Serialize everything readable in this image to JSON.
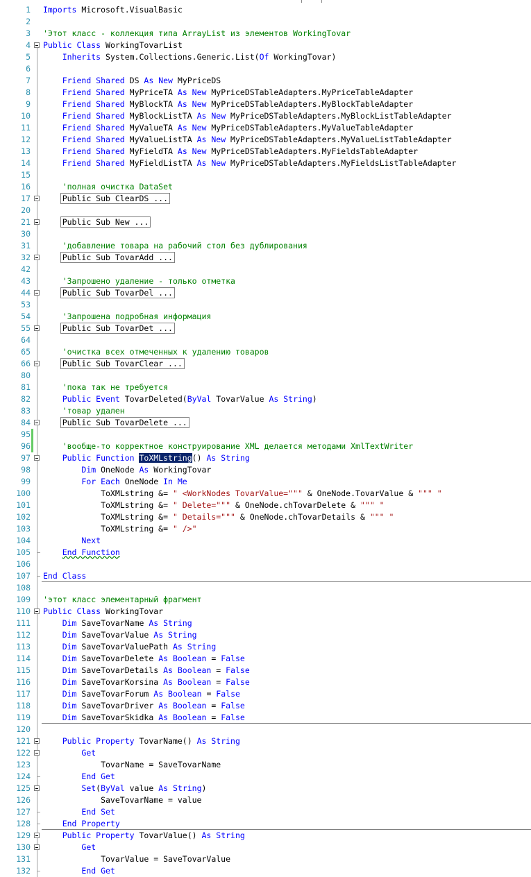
{
  "editor": {
    "lines": [
      {
        "n": "1",
        "t": [
          [
            "kw",
            "Imports"
          ],
          [
            "",
            "Microsoft.VisualBasic"
          ]
        ]
      },
      {
        "n": "2",
        "t": []
      },
      {
        "n": "3",
        "t": [
          [
            "cm",
            "'Этот класс - коллекция типа ArrayList из элементов WorkingTovar"
          ]
        ]
      },
      {
        "n": "4",
        "t": [
          [
            "kw",
            "Public Class"
          ],
          [
            "",
            "WorkingTovarList"
          ]
        ],
        "f": "box"
      },
      {
        "n": "5",
        "t": [
          [
            "",
            "    "
          ],
          [
            "kw",
            "Inherits"
          ],
          [
            "",
            "System.Collections.Generic.List("
          ],
          [
            "kw",
            "Of"
          ],
          [
            "",
            "WorkingTovar)"
          ]
        ]
      },
      {
        "n": "6",
        "t": []
      },
      {
        "n": "7",
        "t": [
          [
            "",
            "    "
          ],
          [
            "kw",
            "Friend Shared"
          ],
          [
            "",
            "DS "
          ],
          [
            "kw",
            "As New"
          ],
          [
            "",
            "MyPriceDS"
          ]
        ]
      },
      {
        "n": "8",
        "t": [
          [
            "",
            "    "
          ],
          [
            "kw",
            "Friend Shared"
          ],
          [
            "",
            "MyPriceTA "
          ],
          [
            "kw",
            "As New"
          ],
          [
            "",
            "MyPriceDSTableAdapters.MyPriceTableAdapter"
          ]
        ]
      },
      {
        "n": "9",
        "t": [
          [
            "",
            "    "
          ],
          [
            "kw",
            "Friend Shared"
          ],
          [
            "",
            "MyBlockTA "
          ],
          [
            "kw",
            "As New"
          ],
          [
            "",
            "MyPriceDSTableAdapters.MyBlockTableAdapter"
          ]
        ]
      },
      {
        "n": "10",
        "t": [
          [
            "",
            "    "
          ],
          [
            "kw",
            "Friend Shared"
          ],
          [
            "",
            "MyBlockListTA "
          ],
          [
            "kw",
            "As New"
          ],
          [
            "",
            "MyPriceDSTableAdapters.MyBlockListTableAdapter"
          ]
        ]
      },
      {
        "n": "11",
        "t": [
          [
            "",
            "    "
          ],
          [
            "kw",
            "Friend Shared"
          ],
          [
            "",
            "MyValueTA "
          ],
          [
            "kw",
            "As New"
          ],
          [
            "",
            "MyPriceDSTableAdapters.MyValueTableAdapter"
          ]
        ]
      },
      {
        "n": "12",
        "t": [
          [
            "",
            "    "
          ],
          [
            "kw",
            "Friend Shared"
          ],
          [
            "",
            "MyValueListTA "
          ],
          [
            "kw",
            "As New"
          ],
          [
            "",
            "MyPriceDSTableAdapters.MyValueListTableAdapter"
          ]
        ]
      },
      {
        "n": "13",
        "t": [
          [
            "",
            "    "
          ],
          [
            "kw",
            "Friend Shared"
          ],
          [
            "",
            "MyFieldTA "
          ],
          [
            "kw",
            "As New"
          ],
          [
            "",
            "MyPriceDSTableAdapters.MyFieldsTableAdapter"
          ]
        ]
      },
      {
        "n": "14",
        "t": [
          [
            "",
            "    "
          ],
          [
            "kw",
            "Friend Shared"
          ],
          [
            "",
            "MyFieldListTA "
          ],
          [
            "kw",
            "As New"
          ],
          [
            "",
            "MyPriceDSTableAdapters.MyFieldsListTableAdapter"
          ]
        ]
      },
      {
        "n": "15",
        "t": []
      },
      {
        "n": "16",
        "t": [
          [
            "",
            "    "
          ],
          [
            "cm",
            "'полная очистка DataSet"
          ]
        ]
      },
      {
        "n": "17",
        "t": [
          [
            "",
            "    "
          ],
          [
            "coll",
            "Public Sub ClearDS ..."
          ]
        ],
        "f": "box"
      },
      {
        "n": "20",
        "t": []
      },
      {
        "n": "21",
        "t": [
          [
            "",
            "    "
          ],
          [
            "coll",
            "Public Sub New ..."
          ]
        ],
        "f": "box"
      },
      {
        "n": "30",
        "t": []
      },
      {
        "n": "31",
        "t": [
          [
            "",
            "    "
          ],
          [
            "cm",
            "'добавление товара на рабочий стол без дублирования"
          ]
        ]
      },
      {
        "n": "32",
        "t": [
          [
            "",
            "    "
          ],
          [
            "coll",
            "Public Sub TovarAdd ..."
          ]
        ],
        "f": "box"
      },
      {
        "n": "42",
        "t": []
      },
      {
        "n": "43",
        "t": [
          [
            "",
            "    "
          ],
          [
            "cm",
            "'Запрошено удаление - только отметка"
          ]
        ]
      },
      {
        "n": "44",
        "t": [
          [
            "",
            "    "
          ],
          [
            "coll",
            "Public Sub TovarDel ..."
          ]
        ],
        "f": "box"
      },
      {
        "n": "53",
        "t": []
      },
      {
        "n": "54",
        "t": [
          [
            "",
            "    "
          ],
          [
            "cm",
            "'Запрошена подробная информация"
          ]
        ]
      },
      {
        "n": "55",
        "t": [
          [
            "",
            "    "
          ],
          [
            "coll",
            "Public Sub TovarDet ..."
          ]
        ],
        "f": "box"
      },
      {
        "n": "64",
        "t": []
      },
      {
        "n": "65",
        "t": [
          [
            "",
            "    "
          ],
          [
            "cm",
            "'очистка всех отмеченных к удалению товаров"
          ]
        ]
      },
      {
        "n": "66",
        "t": [
          [
            "",
            "    "
          ],
          [
            "coll",
            "Public Sub TovarClear ..."
          ]
        ],
        "f": "box"
      },
      {
        "n": "80",
        "t": []
      },
      {
        "n": "81",
        "t": [
          [
            "",
            "    "
          ],
          [
            "cm",
            "'пока так не требуется"
          ]
        ]
      },
      {
        "n": "82",
        "t": [
          [
            "",
            "    "
          ],
          [
            "kw",
            "Public Event"
          ],
          [
            "",
            "TovarDeleted("
          ],
          [
            "kw",
            "ByVal"
          ],
          [
            "",
            "TovarValue "
          ],
          [
            "kw",
            "As String"
          ],
          [
            "",
            ")"
          ]
        ]
      },
      {
        "n": "83",
        "t": [
          [
            "",
            "    "
          ],
          [
            "cm",
            "'товар удален"
          ]
        ]
      },
      {
        "n": "84",
        "t": [
          [
            "",
            "    "
          ],
          [
            "coll",
            "Public Sub TovarDelete ..."
          ]
        ],
        "f": "box"
      },
      {
        "n": "95",
        "t": [],
        "chg": true
      },
      {
        "n": "96",
        "t": [
          [
            "",
            "    "
          ],
          [
            "cm",
            "'вообще-то корректное конструирование XML делается методами XmlTextWriter"
          ]
        ],
        "chg": true
      },
      {
        "n": "97",
        "t": [
          [
            "",
            "    "
          ],
          [
            "kw",
            "Public Function"
          ],
          [
            "sel",
            "ToXMLstring"
          ],
          [
            "",
            "() "
          ],
          [
            "kw",
            "As String"
          ]
        ],
        "f": "box"
      },
      {
        "n": "98",
        "t": [
          [
            "",
            "        "
          ],
          [
            "kw",
            "Dim"
          ],
          [
            "",
            "OneNode "
          ],
          [
            "kw",
            "As"
          ],
          [
            "",
            "WorkingTovar"
          ]
        ]
      },
      {
        "n": "99",
        "t": [
          [
            "",
            "        "
          ],
          [
            "kw",
            "For Each"
          ],
          [
            "",
            "OneNode "
          ],
          [
            "kw",
            "In Me"
          ]
        ]
      },
      {
        "n": "100",
        "t": [
          [
            "",
            "            ToXMLstring &= "
          ],
          [
            "st",
            "\" <WorkNodes TovarValue=\"\"\""
          ],
          [
            "",
            " & OneNode.TovarValue & "
          ],
          [
            "st",
            "\"\"\" \""
          ]
        ]
      },
      {
        "n": "101",
        "t": [
          [
            "",
            "            ToXMLstring &= "
          ],
          [
            "st",
            "\" Delete=\"\"\""
          ],
          [
            "",
            " & OneNode.chTovarDelete & "
          ],
          [
            "st",
            "\"\"\" \""
          ]
        ]
      },
      {
        "n": "102",
        "t": [
          [
            "",
            "            ToXMLstring &= "
          ],
          [
            "st",
            "\" Details=\"\"\""
          ],
          [
            "",
            " & OneNode.chTovarDetails & "
          ],
          [
            "st",
            "\"\"\" \""
          ]
        ]
      },
      {
        "n": "103",
        "t": [
          [
            "",
            "            ToXMLstring &= "
          ],
          [
            "st",
            "\" />\""
          ]
        ]
      },
      {
        "n": "104",
        "t": [
          [
            "",
            "        "
          ],
          [
            "kw",
            "Next"
          ]
        ]
      },
      {
        "n": "105",
        "t": [
          [
            "",
            "    "
          ],
          [
            "kw",
            "End Function"
          ]
        ],
        "f": "end"
      },
      {
        "n": "106",
        "t": []
      },
      {
        "n": "107",
        "t": [
          [
            "kw",
            "End Class"
          ]
        ],
        "f": "end",
        "sep": true
      },
      {
        "n": "108",
        "t": []
      },
      {
        "n": "109",
        "t": [
          [
            "cm",
            "'этот класс элементарный фрагмент"
          ]
        ]
      },
      {
        "n": "110",
        "t": [
          [
            "kw",
            "Public Class"
          ],
          [
            "",
            "WorkingTovar"
          ]
        ],
        "f": "box"
      },
      {
        "n": "111",
        "t": [
          [
            "",
            "    "
          ],
          [
            "kw",
            "Dim"
          ],
          [
            "",
            "SaveTovarName "
          ],
          [
            "kw",
            "As String"
          ]
        ]
      },
      {
        "n": "112",
        "t": [
          [
            "",
            "    "
          ],
          [
            "kw",
            "Dim"
          ],
          [
            "",
            "SaveTovarValue "
          ],
          [
            "kw",
            "As String"
          ]
        ]
      },
      {
        "n": "113",
        "t": [
          [
            "",
            "    "
          ],
          [
            "kw",
            "Dim"
          ],
          [
            "",
            "SaveTovarValuePath "
          ],
          [
            "kw",
            "As String"
          ]
        ]
      },
      {
        "n": "114",
        "t": [
          [
            "",
            "    "
          ],
          [
            "kw",
            "Dim"
          ],
          [
            "",
            "SaveTovarDelete "
          ],
          [
            "kw",
            "As Boolean"
          ],
          [
            "",
            " = "
          ],
          [
            "kw",
            "False"
          ]
        ]
      },
      {
        "n": "115",
        "t": [
          [
            "",
            "    "
          ],
          [
            "kw",
            "Dim"
          ],
          [
            "",
            "SaveTovarDetails "
          ],
          [
            "kw",
            "As Boolean"
          ],
          [
            "",
            " = "
          ],
          [
            "kw",
            "False"
          ]
        ]
      },
      {
        "n": "116",
        "t": [
          [
            "",
            "    "
          ],
          [
            "kw",
            "Dim"
          ],
          [
            "",
            "SaveTovarKorsina "
          ],
          [
            "kw",
            "As Boolean"
          ],
          [
            "",
            " = "
          ],
          [
            "kw",
            "False"
          ]
        ]
      },
      {
        "n": "117",
        "t": [
          [
            "",
            "    "
          ],
          [
            "kw",
            "Dim"
          ],
          [
            "",
            "SaveTovarForum "
          ],
          [
            "kw",
            "As Boolean"
          ],
          [
            "",
            " = "
          ],
          [
            "kw",
            "False"
          ]
        ]
      },
      {
        "n": "118",
        "t": [
          [
            "",
            "    "
          ],
          [
            "kw",
            "Dim"
          ],
          [
            "",
            "SaveTovarDriver "
          ],
          [
            "kw",
            "As Boolean"
          ],
          [
            "",
            " = "
          ],
          [
            "kw",
            "False"
          ]
        ]
      },
      {
        "n": "119",
        "t": [
          [
            "",
            "    "
          ],
          [
            "kw",
            "Dim"
          ],
          [
            "",
            "SaveTovarSkidka "
          ],
          [
            "kw",
            "As Boolean"
          ],
          [
            "",
            " = "
          ],
          [
            "kw",
            "False"
          ]
        ],
        "sep": true
      },
      {
        "n": "120",
        "t": []
      },
      {
        "n": "121",
        "t": [
          [
            "",
            "    "
          ],
          [
            "kw",
            "Public Property"
          ],
          [
            "",
            "TovarName() "
          ],
          [
            "kw",
            "As String"
          ]
        ],
        "f": "box"
      },
      {
        "n": "122",
        "t": [
          [
            "",
            "        "
          ],
          [
            "kw",
            "Get"
          ]
        ],
        "f": "box"
      },
      {
        "n": "123",
        "t": [
          [
            "",
            "            TovarName = SaveTovarName"
          ]
        ]
      },
      {
        "n": "124",
        "t": [
          [
            "",
            "        "
          ],
          [
            "kw",
            "End Get"
          ]
        ],
        "f": "end"
      },
      {
        "n": "125",
        "t": [
          [
            "",
            "        "
          ],
          [
            "kw",
            "Set"
          ],
          [
            "",
            "("
          ],
          [
            "kw",
            "ByVal"
          ],
          [
            "",
            "value "
          ],
          [
            "kw",
            "As String"
          ],
          [
            "",
            ")"
          ]
        ],
        "f": "box"
      },
      {
        "n": "126",
        "t": [
          [
            "",
            "            SaveTovarName = value"
          ]
        ]
      },
      {
        "n": "127",
        "t": [
          [
            "",
            "        "
          ],
          [
            "kw",
            "End Set"
          ]
        ],
        "f": "end"
      },
      {
        "n": "128",
        "t": [
          [
            "",
            "    "
          ],
          [
            "kw",
            "End Property"
          ]
        ],
        "f": "end",
        "sep": true
      },
      {
        "n": "129",
        "t": [
          [
            "",
            "    "
          ],
          [
            "kw",
            "Public Property"
          ],
          [
            "",
            "TovarValue() "
          ],
          [
            "kw",
            "As String"
          ]
        ],
        "f": "box"
      },
      {
        "n": "130",
        "t": [
          [
            "",
            "        "
          ],
          [
            "kw",
            "Get"
          ]
        ],
        "f": "box"
      },
      {
        "n": "131",
        "t": [
          [
            "",
            "            TovarValue = SaveTovarValue"
          ]
        ]
      },
      {
        "n": "132",
        "t": [
          [
            "",
            "        "
          ],
          [
            "kw",
            "End Get"
          ]
        ],
        "f": "end"
      }
    ]
  }
}
